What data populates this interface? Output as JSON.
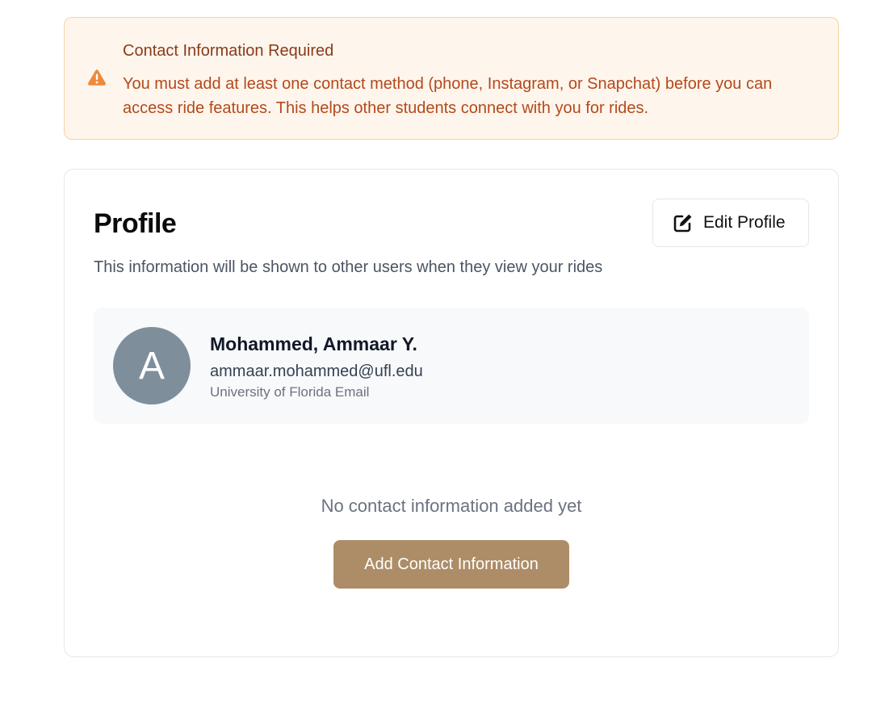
{
  "alert": {
    "icon": "warning-triangle-icon",
    "title": "Contact Information Required",
    "body": "You must add at least one contact method (phone, Instagram, or Snapchat) before you can access ride features. This helps other students connect with you for rides.",
    "colors": {
      "background": "#fef6ec",
      "border": "#f3d3a4",
      "title": "#8a3a1a",
      "body": "#b4481c",
      "icon": "#ee8a3c"
    }
  },
  "profile": {
    "title": "Profile",
    "subtitle": "This information will be shown to other users when they view your rides",
    "edit_button": {
      "icon": "edit-square-icon",
      "label": "Edit Profile"
    },
    "user": {
      "avatar_initial": "A",
      "avatar_color": "#7e8f9b",
      "name": "Mohammed, Ammaar Y.",
      "email": "ammaar.mohammed@ufl.edu",
      "email_note": "University of Florida Email"
    },
    "empty_state": {
      "message": "No contact information added yet",
      "button_label": "Add Contact Information",
      "button_color": "#ad8d67"
    }
  }
}
